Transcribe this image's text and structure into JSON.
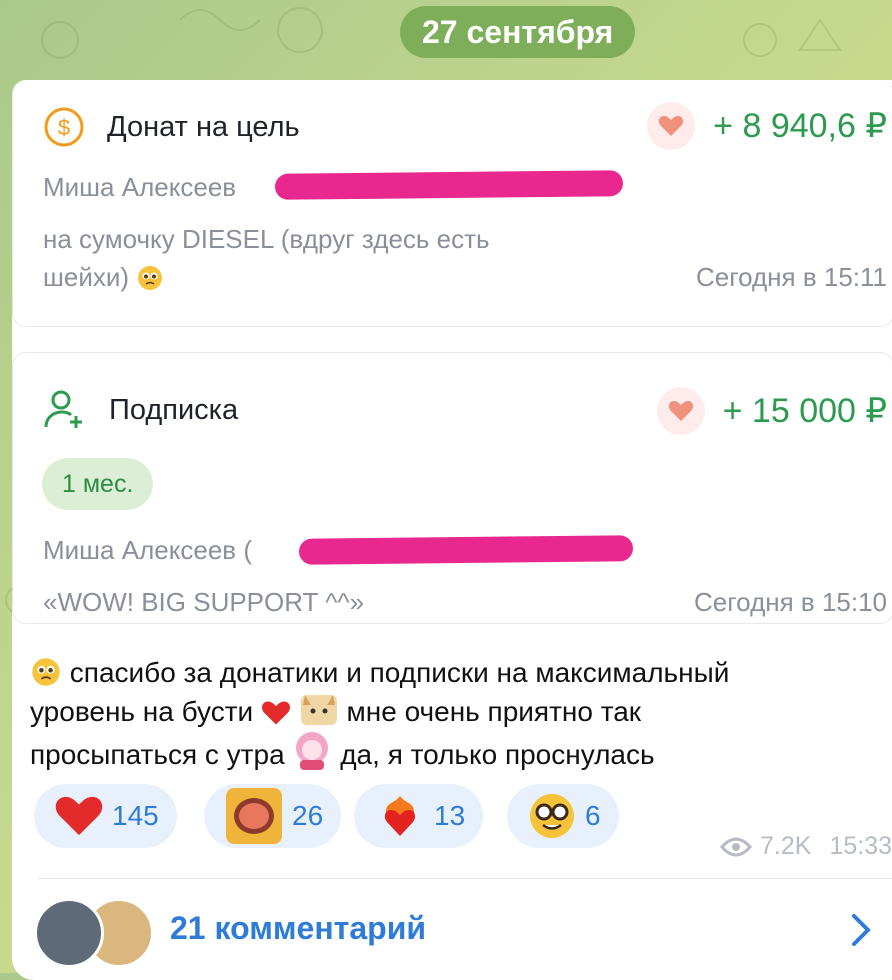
{
  "date_label": "27 сентября",
  "donation": {
    "title": "Донат на цель",
    "amount": "+ 8 940,6 ₽",
    "sender": "Миша Алексеев",
    "note_line1": "на сумочку DIESEL (вдруг здесь есть",
    "note_line2": "шейхи)",
    "time": "Сегодня в 15:11"
  },
  "subscription": {
    "title": "Подписка",
    "amount": "+ 15 000 ₽",
    "period": "1 мес.",
    "sender": "Миша Алексеев (",
    "note": "«WOW! BIG SUPPORT ^^»",
    "time": "Сегодня в 15:10"
  },
  "message": {
    "line1": "спасибо за донатики и подписки на максимальный",
    "line2_a": "уровень на бусти",
    "line2_b": "мне очень приятно так",
    "line3_a": "просыпаться с утра",
    "line3_b": "да, я только проснулась"
  },
  "reactions": [
    {
      "icon": "red-heart-icon",
      "count": "145"
    },
    {
      "icon": "sticker-icon",
      "count": "26"
    },
    {
      "icon": "heart-on-fire-icon",
      "count": "13"
    },
    {
      "icon": "nerd-face-icon",
      "count": "6"
    }
  ],
  "meta": {
    "views": "7.2K",
    "time": "15:33"
  },
  "comments_label": "21 комментарий",
  "colors": {
    "accent_blue": "#2f7cd8",
    "green": "#2c9a4f",
    "redaction": "#e8288f",
    "date_pill": "#7fae5a"
  }
}
